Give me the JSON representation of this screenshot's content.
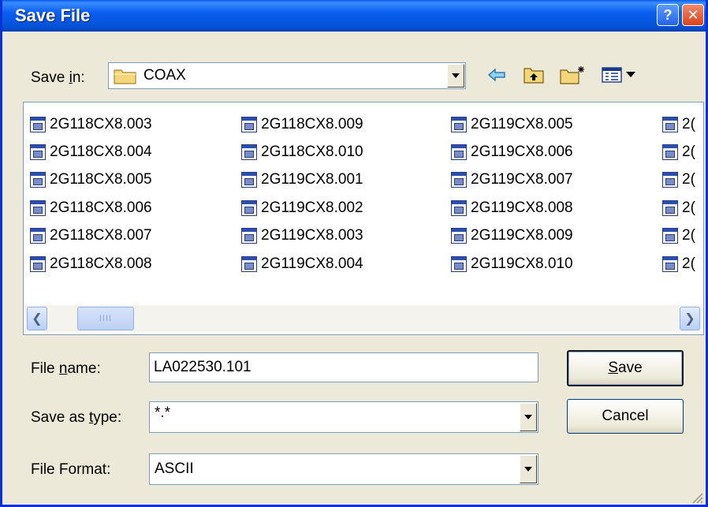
{
  "window": {
    "title": "Save File",
    "help_glyph": "?",
    "close_glyph": "✕"
  },
  "save_in": {
    "label_prefix": "Save ",
    "label_accel": "i",
    "label_suffix": "n:",
    "value": "COAX"
  },
  "toolbar": {
    "icons": [
      "back-arrow-icon",
      "up-folder-icon",
      "new-folder-icon",
      "view-menu-icon"
    ]
  },
  "files": {
    "columns": [
      [
        "2G118CX8.003",
        "2G118CX8.004",
        "2G118CX8.005",
        "2G118CX8.006",
        "2G118CX8.007",
        "2G118CX8.008"
      ],
      [
        "2G118CX8.009",
        "2G118CX8.010",
        "2G119CX8.001",
        "2G119CX8.002",
        "2G119CX8.003",
        "2G119CX8.004"
      ],
      [
        "2G119CX8.005",
        "2G119CX8.006",
        "2G119CX8.007",
        "2G119CX8.008",
        "2G119CX8.009",
        "2G119CX8.010"
      ],
      [
        "2(",
        "2(",
        "2(",
        "2(",
        "2(",
        "2("
      ]
    ],
    "scroll_left_glyph": "❮",
    "scroll_right_glyph": "❯",
    "thumb_grip": "IIII"
  },
  "file_name": {
    "label_prefix": "File ",
    "label_accel": "n",
    "label_suffix": "ame:",
    "value": "LA022530.101"
  },
  "save_as_type": {
    "label_prefix": "Save as ",
    "label_accel": "t",
    "label_suffix": "ype:",
    "value": "*.*"
  },
  "file_format": {
    "label": "File Format:",
    "value": "ASCII"
  },
  "buttons": {
    "save_accel": "S",
    "save_rest": "ave",
    "cancel": "Cancel"
  },
  "colors": {
    "titlebar": "#0552d8",
    "dialog_bg": "#ece9d8",
    "field_border": "#7f9db9"
  }
}
